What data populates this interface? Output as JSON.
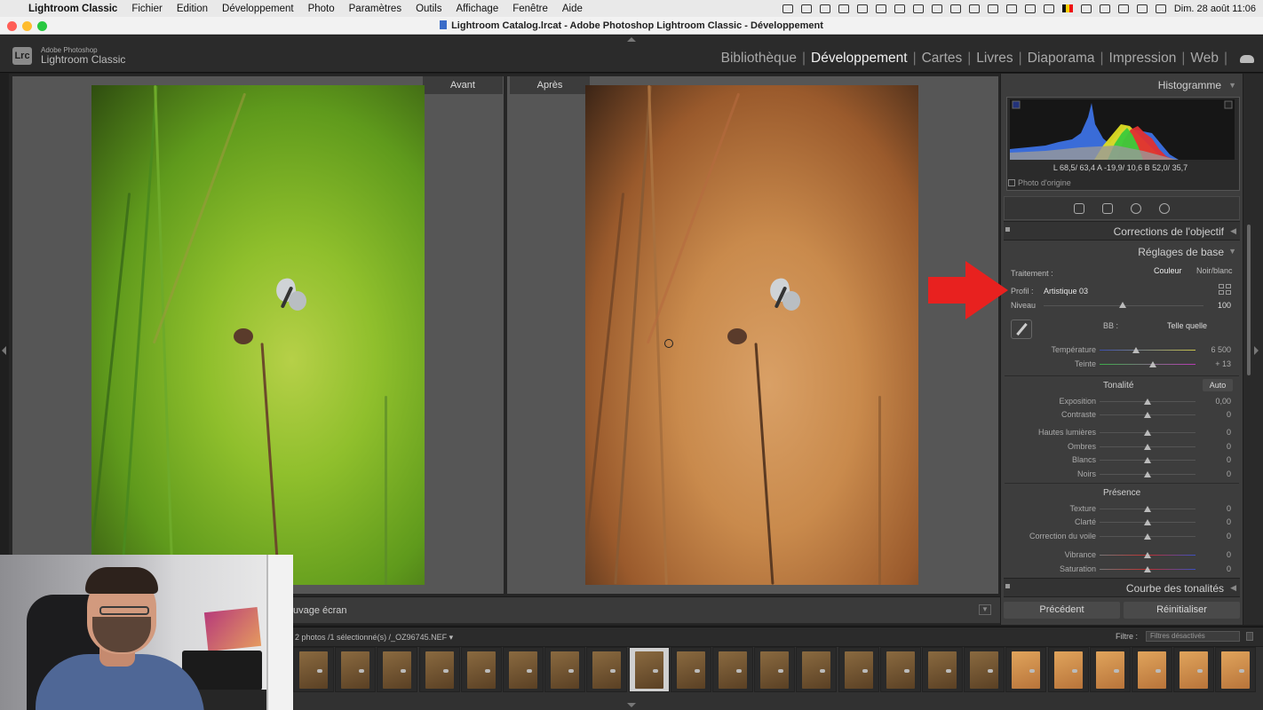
{
  "menubar": {
    "app": "Lightroom Classic",
    "items": [
      "Fichier",
      "Edition",
      "Développement",
      "Photo",
      "Paramètres",
      "Outils",
      "Affichage",
      "Fenêtre",
      "Aide"
    ],
    "datetime": "Dim. 28 août  11:06"
  },
  "window": {
    "title": "Lightroom Catalog.lrcat - Adobe Photoshop Lightroom Classic - Développement"
  },
  "brand": {
    "logo": "Lrc",
    "line1": "Adobe Photoshop",
    "line2": "Lightroom Classic"
  },
  "modules": [
    {
      "label": "Bibliothèque",
      "active": false
    },
    {
      "label": "Développement",
      "active": true
    },
    {
      "label": "Cartes",
      "active": false
    },
    {
      "label": "Livres",
      "active": false
    },
    {
      "label": "Diaporama",
      "active": false
    },
    {
      "label": "Impression",
      "active": false
    },
    {
      "label": "Web",
      "active": false
    }
  ],
  "compare": {
    "before": "Avant",
    "after": "Après"
  },
  "toolbar": {
    "text": "uvage écran"
  },
  "histogram": {
    "title": "Histogramme",
    "readout": "L  68,5/ 63,4   A  -19,9/ 10,6   B  52,0/  35,7",
    "original": "Photo d'origine"
  },
  "panels": {
    "lens": "Corrections de l'objectif",
    "basic": "Réglages de base",
    "curve": "Courbe des tonalités"
  },
  "basic": {
    "treatment_label": "Traitement :",
    "color": "Couleur",
    "bw": "Noir/blanc",
    "profile_label": "Profil :",
    "profile_value": "Artistique 03",
    "level_label": "Niveau",
    "level_value": "100",
    "wb_label": "BB :",
    "wb_value": "Telle quelle",
    "tonality": "Tonalité",
    "auto": "Auto",
    "presence": "Présence"
  },
  "sliders": [
    {
      "key": "temperature",
      "label": "Température",
      "value": "6 500",
      "pos": 0.38
    },
    {
      "key": "tint",
      "label": "Teinte",
      "value": "+ 13",
      "pos": 0.56
    },
    {
      "key": "exposure",
      "label": "Exposition",
      "value": "0,00",
      "pos": 0.5
    },
    {
      "key": "contrast",
      "label": "Contraste",
      "value": "0",
      "pos": 0.5
    },
    {
      "key": "highlights",
      "label": "Hautes lumières",
      "value": "0",
      "pos": 0.5
    },
    {
      "key": "shadows",
      "label": "Ombres",
      "value": "0",
      "pos": 0.5
    },
    {
      "key": "whites",
      "label": "Blancs",
      "value": "0",
      "pos": 0.5
    },
    {
      "key": "blacks",
      "label": "Noirs",
      "value": "0",
      "pos": 0.5
    },
    {
      "key": "texture",
      "label": "Texture",
      "value": "0",
      "pos": 0.5
    },
    {
      "key": "clarity",
      "label": "Clarté",
      "value": "0",
      "pos": 0.5
    },
    {
      "key": "dehaze",
      "label": "Correction du voile",
      "value": "0",
      "pos": 0.5
    },
    {
      "key": "vibrance",
      "label": "Vibrance",
      "value": "0",
      "pos": 0.5
    },
    {
      "key": "saturation",
      "label": "Saturation",
      "value": "0",
      "pos": 0.5
    }
  ],
  "buttons": {
    "previous": "Précédent",
    "reset": "Réinitialiser"
  },
  "filmstrip": {
    "info": "2 photos /1 sélectionné(s) /_OZ96745.NEF",
    "filter_label": "Filtre :",
    "filter_value": "Filtres désactivés"
  },
  "colors": {
    "accent_red": "#e8211f",
    "active_module": "#f0f0f0"
  }
}
